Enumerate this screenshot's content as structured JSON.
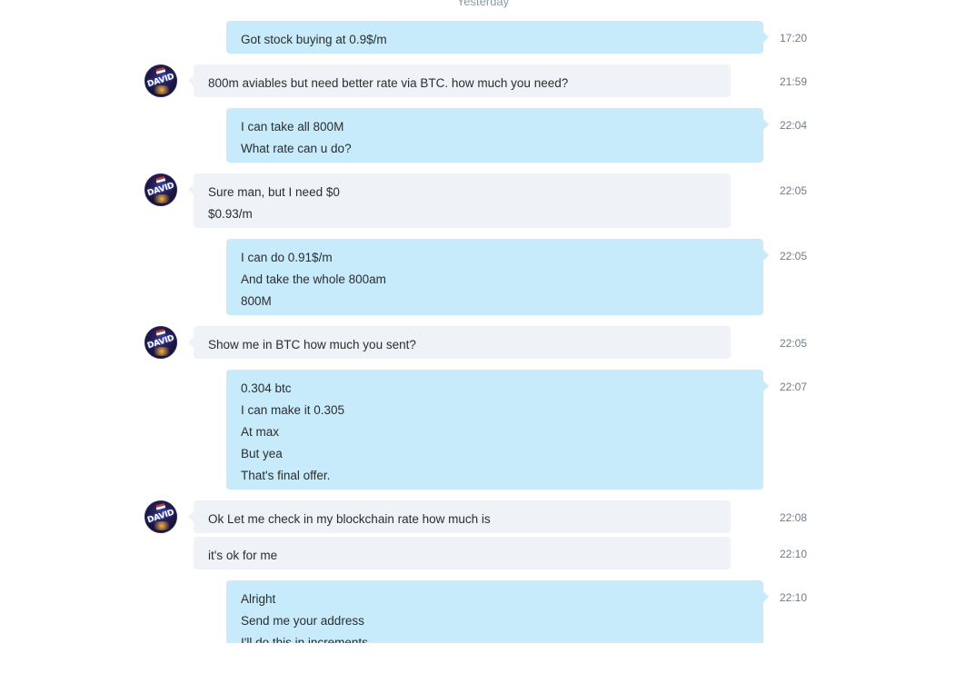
{
  "day_divider": "Yesterday",
  "avatar_text": "DAVID",
  "colors": {
    "incoming_bubble": "#eff2f7",
    "outgoing_bubble": "#c7ebfa",
    "timestamp": "#6f7d8a"
  },
  "messages": [
    {
      "dir": "out",
      "time": "17:20",
      "lines": [
        "Got stock buying at 0.9$/m"
      ]
    },
    {
      "dir": "in",
      "time": "21:59",
      "lines": [
        "800m aviables but need better rate via BTC. how much you need?"
      ]
    },
    {
      "dir": "out",
      "time": "22:04",
      "lines": [
        "I can take all 800M",
        "What rate can u do?"
      ]
    },
    {
      "dir": "in",
      "time": "22:05",
      "lines": [
        "Sure man, but I need $0",
        "$0.93/m"
      ]
    },
    {
      "dir": "out",
      "time": "22:05",
      "lines": [
        "I can do 0.91$/m",
        "And take the whole 800am",
        "800M"
      ]
    },
    {
      "dir": "in",
      "time": "22:05",
      "lines": [
        "Show me in BTC how much you sent?"
      ]
    },
    {
      "dir": "out",
      "time": "22:07",
      "lines": [
        "0.304 btc",
        "I can make it 0.305",
        "At max",
        "But yea",
        "That's final offer."
      ]
    },
    {
      "dir": "in",
      "time": "22:08",
      "lines": [
        "Ok Let me check in my blockchain rate how much is"
      ]
    },
    {
      "dir": "in",
      "time": "22:10",
      "lines": [
        "it's ok for me"
      ]
    },
    {
      "dir": "out",
      "time": "22:10",
      "lines": [
        "Alright",
        "Send me your address",
        "I'll do this in increments"
      ]
    }
  ]
}
